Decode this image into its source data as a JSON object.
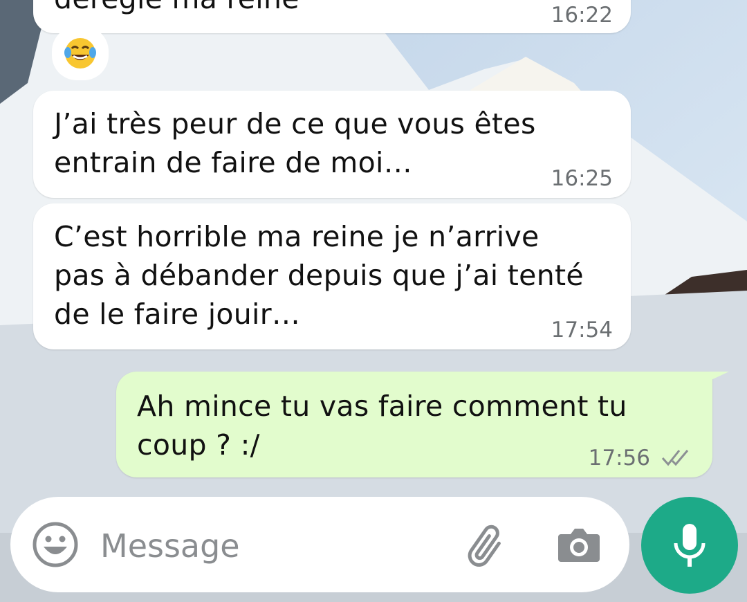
{
  "theme": {
    "incoming_bubble": "#ffffff",
    "outgoing_bubble": "#e2fccd",
    "accent": "#1daa88"
  },
  "messages": [
    {
      "direction": "in",
      "text": "déréglé ma reine",
      "time": "16:22"
    },
    {
      "direction": "reaction",
      "emoji": "😂",
      "icon": "face-with-tears-of-joy-icon"
    },
    {
      "direction": "in",
      "text": "J’ai très peur de ce que vous êtes\nentrain de faire de moi…",
      "time": "16:25"
    },
    {
      "direction": "in",
      "text": "C’est horrible ma reine je n’arrive\npas à débander depuis que j’ai tenté\nde le faire jouir…",
      "time": "17:54"
    },
    {
      "direction": "out",
      "text": "Ah mince tu vas faire comment tu\ncoup ? :/",
      "time": "17:56",
      "status": "read-double-check-icon"
    }
  ],
  "composer": {
    "placeholder": "Message",
    "icons": [
      "emoji-icon",
      "paperclip-icon",
      "camera-icon",
      "microphone-icon"
    ]
  }
}
